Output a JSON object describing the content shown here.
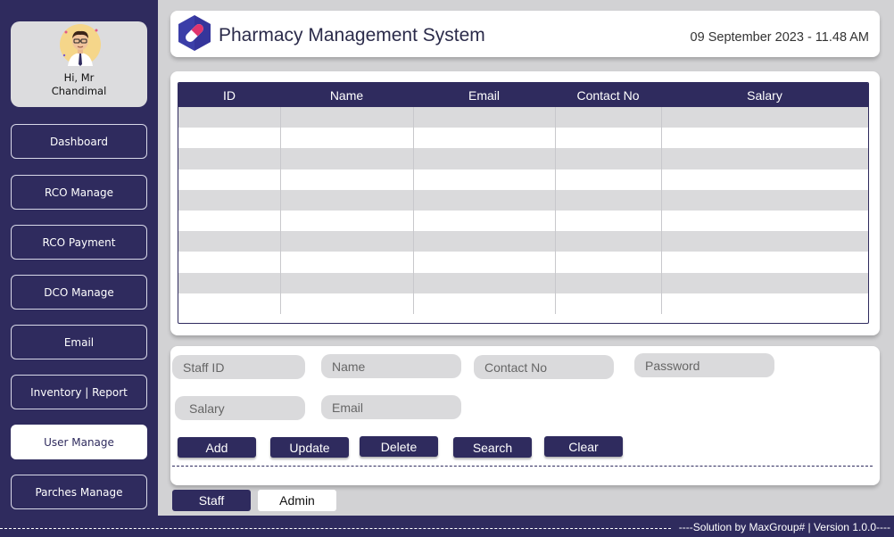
{
  "app": {
    "title": "Pharmacy Management System",
    "datetime": "09 September 2023 - 11.48 AM"
  },
  "user": {
    "greeting_line1": "Hi, Mr",
    "greeting_line2": "Chandimal"
  },
  "sidebar": {
    "items": [
      {
        "label": "Dashboard"
      },
      {
        "label": "RCO Manage"
      },
      {
        "label": "RCO Payment"
      },
      {
        "label": "DCO Manage"
      },
      {
        "label": "Email"
      },
      {
        "label": "Inventory | Report"
      },
      {
        "label": "User Manage",
        "active": true
      },
      {
        "label": "Parches Manage"
      }
    ]
  },
  "table": {
    "columns": [
      "ID",
      "Name",
      "Email",
      "Contact No",
      "Salary"
    ],
    "rows": []
  },
  "form": {
    "staff_id_placeholder": "Staff ID",
    "name_placeholder": "Name",
    "contact_placeholder": "Contact No",
    "password_placeholder": "Password",
    "salary_placeholder": "Salary",
    "email_placeholder": "Email"
  },
  "actions": {
    "add": "Add",
    "update": "Update",
    "delete": "Delete",
    "search": "Search",
    "clear": "Clear"
  },
  "tabs": {
    "staff": "Staff",
    "admin": "Admin"
  },
  "footer": {
    "text": "----Solution by MaxGroup# | Version 1.0.0----"
  },
  "colors": {
    "primary": "#2f2b5e",
    "background": "#d2d2d4",
    "panel": "#ffffff",
    "stripe": "#dadadc"
  }
}
